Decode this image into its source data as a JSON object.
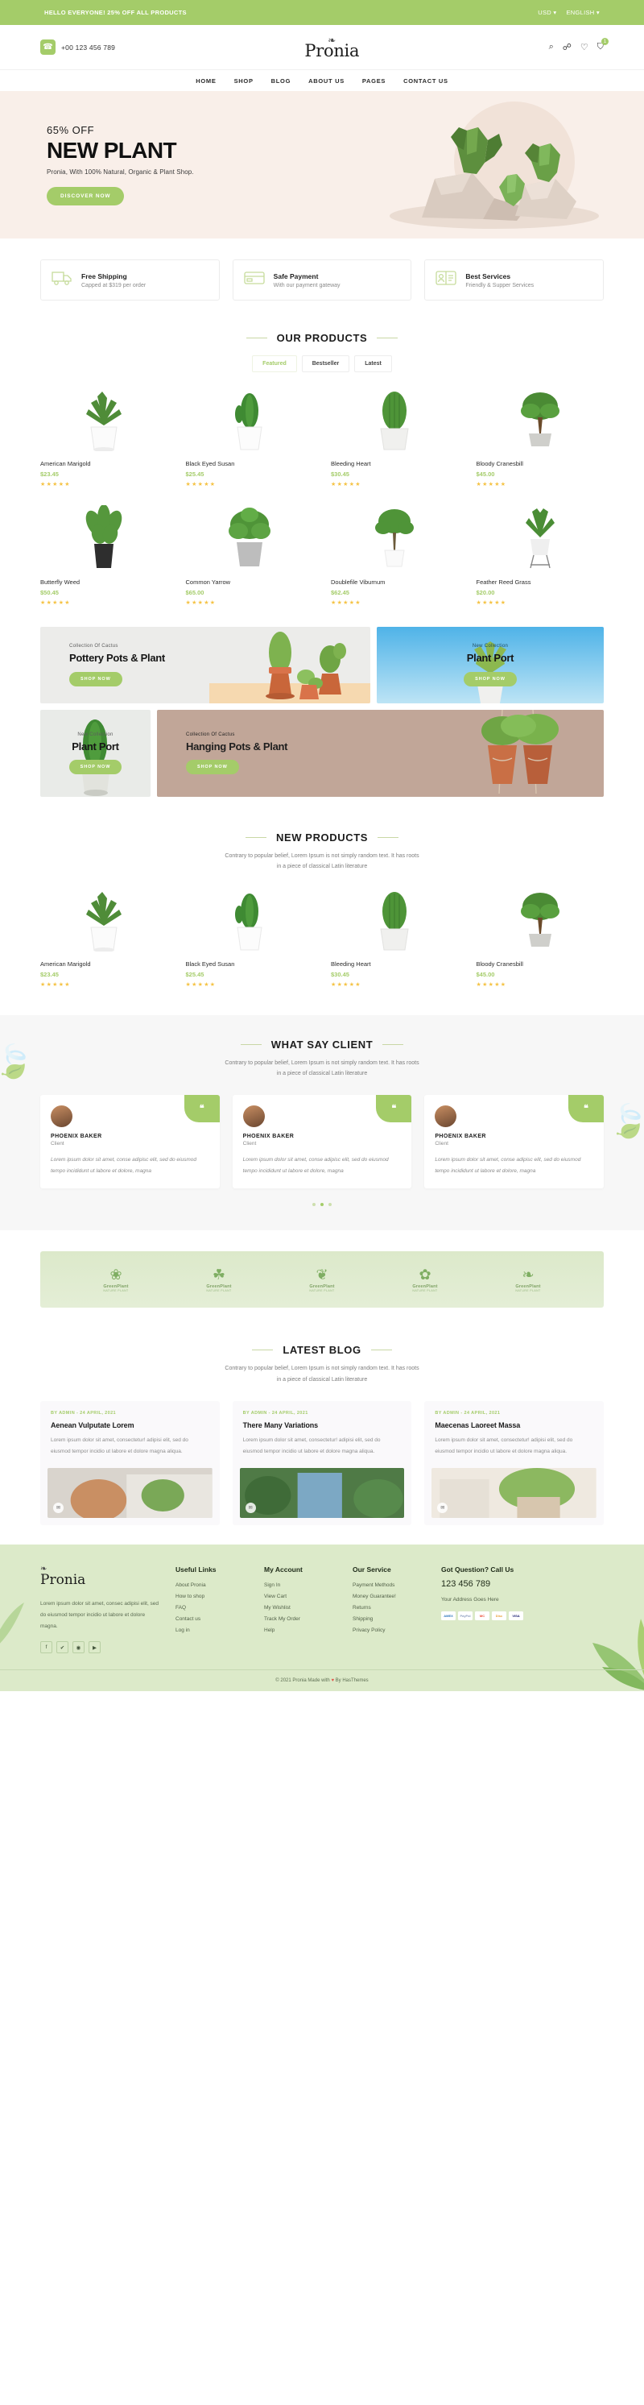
{
  "topbar": {
    "message": "HELLO EVERYONE! 25% OFF ALL PRODUCTS",
    "currency": "USD",
    "language": "ENGLISH",
    "caret": "▾"
  },
  "header": {
    "phone": "+00 123 456 789",
    "phone_icon": "☎",
    "logo": "Pronia",
    "logo_leaf": "❧",
    "search_icon": "⌕",
    "account_icon": "☍",
    "wishlist_icon": "♡",
    "cart_icon": "⛉",
    "cart_count": "1"
  },
  "nav": {
    "items": [
      {
        "label": "HOME"
      },
      {
        "label": "SHOP"
      },
      {
        "label": "BLOG"
      },
      {
        "label": "ABOUT US"
      },
      {
        "label": "PAGES"
      },
      {
        "label": "CONTACT US"
      }
    ]
  },
  "hero": {
    "offer": "65% OFF",
    "title": "NEW PLANT",
    "subtitle": "Pronia, With 100% Natural, Organic & Plant Shop.",
    "cta": "DISCOVER NOW",
    "bg_color": "#f9efe9"
  },
  "services": [
    {
      "title": "Free Shipping",
      "subtitle": "Capped at $319 per order",
      "icon": "truck-icon"
    },
    {
      "title": "Safe Payment",
      "subtitle": "With our payment gateway",
      "icon": "card-icon"
    },
    {
      "title": "Best Services",
      "subtitle": "Friendly & Supper Services",
      "icon": "support-icon"
    }
  ],
  "our_products": {
    "title": "OUR PRODUCTS",
    "tabs": [
      {
        "label": "Featured",
        "active": true
      },
      {
        "label": "Bestseller",
        "active": false
      },
      {
        "label": "Latest",
        "active": false
      }
    ],
    "items": [
      {
        "name": "American Marigold",
        "price": "$23.45",
        "stars": "★★★★★"
      },
      {
        "name": "Black Eyed Susan",
        "price": "$25.45",
        "stars": "★★★★★"
      },
      {
        "name": "Bleeding Heart",
        "price": "$30.45",
        "stars": "★★★★★"
      },
      {
        "name": "Bloody Cranesbill",
        "price": "$45.00",
        "stars": "★★★★★"
      },
      {
        "name": "Butterfly Weed",
        "price": "$50.45",
        "stars": "★★★★★"
      },
      {
        "name": "Common Yarrow",
        "price": "$65.00",
        "stars": "★★★★★"
      },
      {
        "name": "Doublefile Viburnum",
        "price": "$62.45",
        "stars": "★★★★★"
      },
      {
        "name": "Feather Reed Grass",
        "price": "$20.00",
        "stars": "★★★★★"
      }
    ]
  },
  "promos": {
    "pottery": {
      "eyebrow": "Collection Of Cactus",
      "title": "Pottery Pots & Plant",
      "cta": "SHOP NOW"
    },
    "plantport_blue": {
      "eyebrow": "New Collection",
      "title": "Plant Port",
      "cta": "SHOP NOW"
    },
    "plantport_grey": {
      "eyebrow": "New Collection",
      "title": "Plant Port",
      "cta": "SHOP NOW"
    },
    "hanging": {
      "eyebrow": "Collection Of Cactus",
      "title": "Hanging Pots & Plant",
      "cta": "SHOP NOW"
    }
  },
  "new_products": {
    "title": "NEW PRODUCTS",
    "desc_line1": "Contrary to popular belief, Lorem Ipsum is not simply random text. It has roots",
    "desc_line2": "in a piece of classical Latin literature",
    "items": [
      {
        "name": "American Marigold",
        "price": "$23.45",
        "stars": "★★★★★"
      },
      {
        "name": "Black Eyed Susan",
        "price": "$25.45",
        "stars": "★★★★★"
      },
      {
        "name": "Bleeding Heart",
        "price": "$30.45",
        "stars": "★★★★★"
      },
      {
        "name": "Bloody Cranesbill",
        "price": "$45.00",
        "stars": "★★★★★"
      }
    ]
  },
  "testimonials": {
    "title": "WHAT SAY CLIENT",
    "desc_line1": "Contrary to popular belief, Lorem Ipsum is not simply random text. It has roots",
    "desc_line2": "in a piece of classical Latin literature",
    "quote_mark": "❝",
    "items": [
      {
        "name": "PHOENIX BAKER",
        "role": "Client",
        "text": "Lorem ipsum dolor sit amet, conse adipisc elit, sed do eiusmod tempo incididunt ut labore et dolore, magna"
      },
      {
        "name": "PHOENIX BAKER",
        "role": "Client",
        "text": "Lorem ipsum dolor sit amet, conse adipisc elit, sed do eiusmod tempo incididunt ut labore et dolore, magna"
      },
      {
        "name": "PHOENIX BAKER",
        "role": "Client",
        "text": "Lorem ipsum dolor sit amet, conse adipisc elit, sed do eiusmod tempo incididunt ut labore et dolore, magna"
      }
    ]
  },
  "brands": [
    {
      "name": "GreenPlant",
      "tagline": "NATURE PLANT",
      "mark": "❀"
    },
    {
      "name": "GreenPlant",
      "tagline": "NATURE PLANT",
      "mark": "☘"
    },
    {
      "name": "GreenPlant",
      "tagline": "NATURE PLANT",
      "mark": "❦"
    },
    {
      "name": "GreenPlant",
      "tagline": "NATURE PLANT",
      "mark": "✿"
    },
    {
      "name": "GreenPlant",
      "tagline": "NATURE PLANT",
      "mark": "❧"
    }
  ],
  "blog": {
    "title": "LATEST BLOG",
    "desc_line1": "Contrary to popular belief, Lorem Ipsum is not simply random text. It has roots",
    "desc_line2": "in a piece of classical Latin literature",
    "posts": [
      {
        "meta": "BY ADMIN - 24 APRIL, 2021",
        "title": "Aenean Vulputate Lorem",
        "text": "Lorem ipsum dolor sit amet, consectetur! adipisi elit, sed do eiusmod tempor incidio ut labore et dolore magna aliqua.",
        "fab": "✉"
      },
      {
        "meta": "BY ADMIN - 24 APRIL, 2021",
        "title": "There Many Variations",
        "text": "Lorem ipsum dolor sit amet, consectetur! adipisi elit, sed do eiusmod tempor incidio ut labore et dolore magna aliqua.",
        "fab": "✉"
      },
      {
        "meta": "BY ADMIN - 24 APRIL, 2021",
        "title": "Maecenas Laoreet Massa",
        "text": "Lorem ipsum dolor sit amet, consectetur! adipisi elit, sed do eiusmod tempor incidio ut labore et dolore magna aliqua.",
        "fab": "✉"
      }
    ]
  },
  "footer": {
    "logo": "Pronia",
    "logo_leaf": "❧",
    "about": "Lorem ipsum dolor sit amet, consec adipisi elit, sed do eiusmod tempor incidio ut labore et dolore magna.",
    "social": [
      {
        "name": "facebook",
        "glyph": "f"
      },
      {
        "name": "twitter",
        "glyph": "✔"
      },
      {
        "name": "instagram",
        "glyph": "◉"
      },
      {
        "name": "youtube",
        "glyph": "▶"
      }
    ],
    "useful_links": {
      "head": "Useful Links",
      "items": [
        "About Pronia",
        "How to shop",
        "FAQ",
        "Contact us",
        "Log in"
      ]
    },
    "my_account": {
      "head": "My Account",
      "items": [
        "Sign In",
        "View Cart",
        "My Wishlist",
        "Track My Order",
        "Help"
      ]
    },
    "our_service": {
      "head": "Our Service",
      "items": [
        "Payment Methods",
        "Money Guarantee!",
        "Returns",
        "Shipping",
        "Privacy Policy"
      ]
    },
    "contact": {
      "head": "Got Question? Call Us",
      "phone": "123 456 789",
      "address": "Your Address Goes Here",
      "payments": [
        "AMEX",
        "PayPal",
        "MC",
        "Disc",
        "VISA"
      ]
    },
    "copyright_pre": "© 2021 Pronia Made with ",
    "copyright_heart": "♥",
    "copyright_post": " By HasThemes"
  }
}
